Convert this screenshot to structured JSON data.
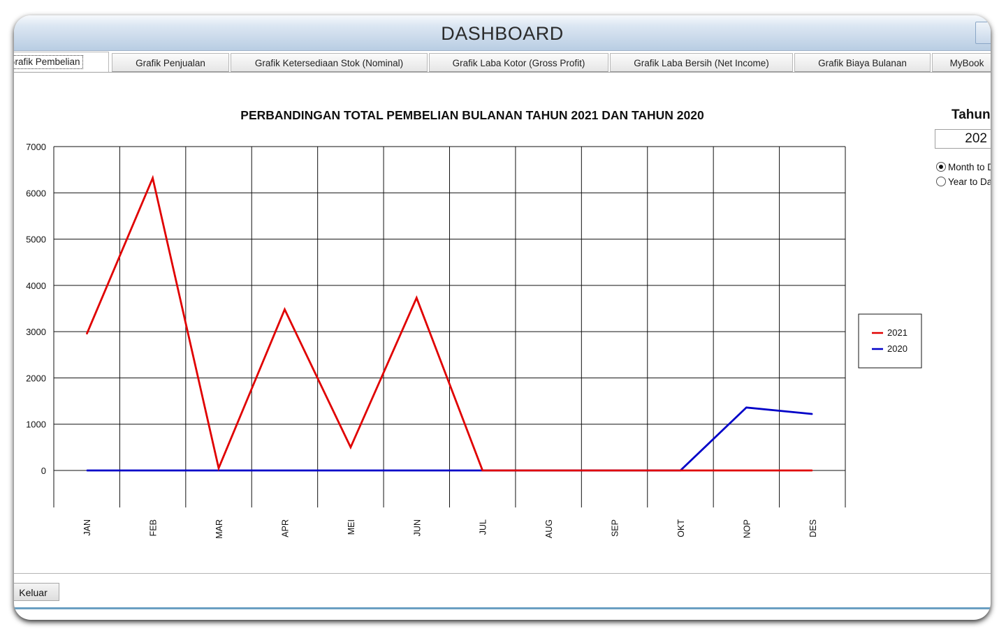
{
  "window": {
    "title": "DASHBOARD"
  },
  "tabs": [
    {
      "label": "Grafik Pembelian",
      "active": true
    },
    {
      "label": "Grafik Penjualan"
    },
    {
      "label": "Grafik Ketersediaan Stok (Nominal)"
    },
    {
      "label": "Grafik Laba Kotor (Gross Profit)"
    },
    {
      "label": "Grafik Laba Bersih (Net Income)"
    },
    {
      "label": "Grafik Biaya Bulanan"
    },
    {
      "label": "MyBook"
    }
  ],
  "controls": {
    "tahun_label": "Tahun",
    "year_value": "202",
    "radio_month": "Month to D",
    "radio_year": "Year to Da",
    "selected": "month"
  },
  "footer": {
    "keluar_label": "Keluar"
  },
  "chart_data": {
    "type": "line",
    "title": "PERBANDINGAN TOTAL PEMBELIAN BULANAN TAHUN 2021 DAN TAHUN 2020",
    "categories": [
      "JAN",
      "FEB",
      "MAR",
      "APR",
      "MEI",
      "JUN",
      "JUL",
      "AUG",
      "SEP",
      "OKT",
      "NOP",
      "DES"
    ],
    "y_ticks": [
      0,
      1000,
      2000,
      3000,
      4000,
      5000,
      6000,
      7000
    ],
    "ylim": [
      -800,
      7000
    ],
    "grid": true,
    "legend_position": "right",
    "series": [
      {
        "name": "2021",
        "color": "#e00000",
        "values": [
          2950,
          6320,
          50,
          3480,
          500,
          3730,
          0,
          0,
          0,
          0,
          0,
          0
        ]
      },
      {
        "name": "2020",
        "color": "#0000c8",
        "values": [
          0,
          0,
          0,
          0,
          0,
          0,
          0,
          0,
          0,
          0,
          1360,
          1220
        ]
      }
    ]
  }
}
